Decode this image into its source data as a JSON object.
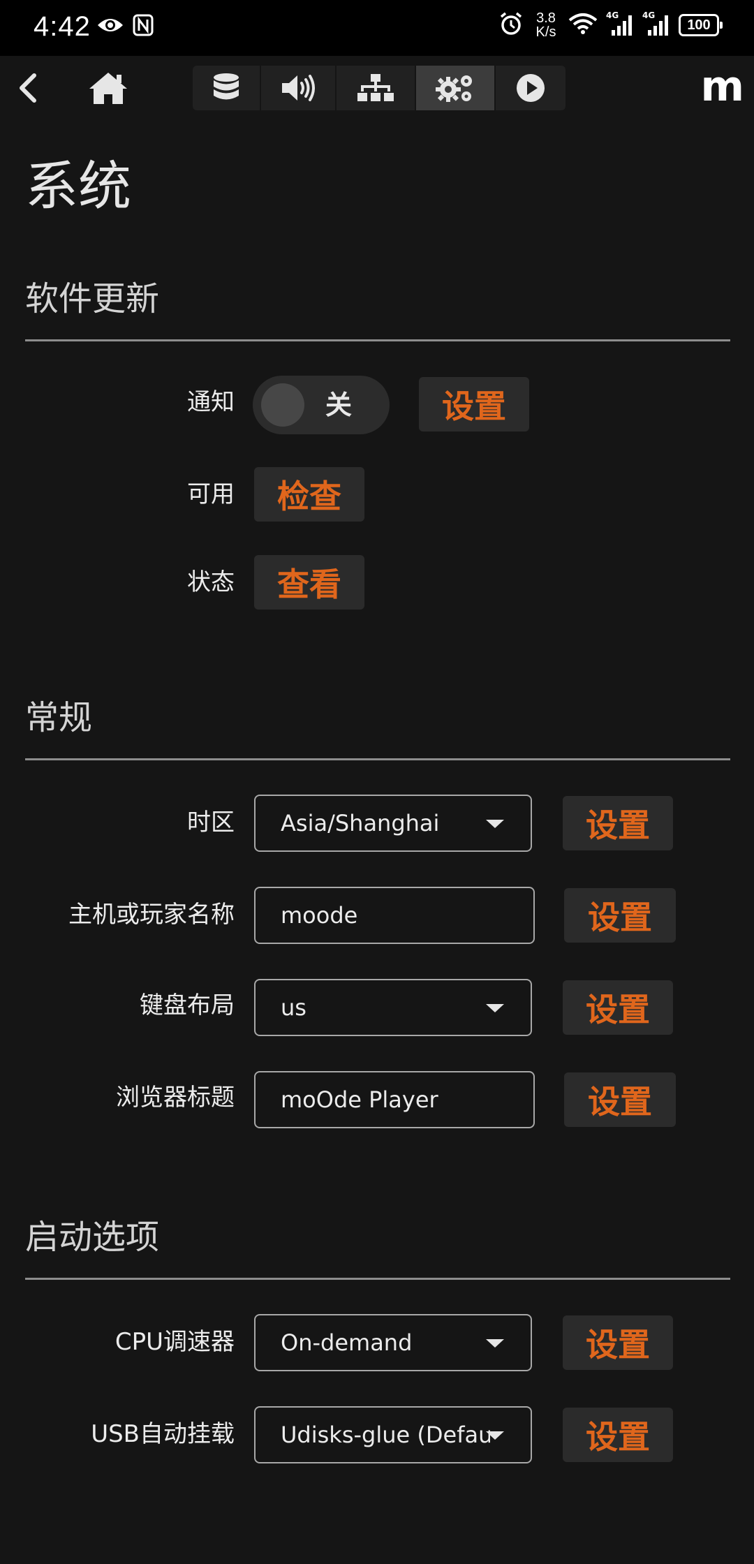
{
  "status_bar": {
    "time": "4:42",
    "net_speed_value": "3.8",
    "net_speed_unit": "K/s",
    "network_label_1": "4G",
    "network_label_2": "4G",
    "battery": "100"
  },
  "nav": {
    "brand": "m",
    "tabs": [
      {
        "name": "library",
        "icon": "database-icon"
      },
      {
        "name": "audio",
        "icon": "speaker-icon"
      },
      {
        "name": "network",
        "icon": "sitemap-icon"
      },
      {
        "name": "system",
        "icon": "gears-icon",
        "active": true
      },
      {
        "name": "playback",
        "icon": "play-circle-icon"
      }
    ]
  },
  "page": {
    "title": "系统"
  },
  "software_update": {
    "heading": "软件更新",
    "notify_label": "通知",
    "notify_toggle": "关",
    "notify_button": "设置",
    "available_label": "可用",
    "check_button": "检查",
    "status_label": "状态",
    "view_button": "查看"
  },
  "general": {
    "heading": "常规",
    "timezone_label": "时区",
    "timezone_value": "Asia/Shanghai",
    "timezone_button": "设置",
    "hostname_label": "主机或玩家名称",
    "hostname_value": "moode",
    "hostname_button": "设置",
    "keyboard_label": "键盘布局",
    "keyboard_value": "us",
    "keyboard_button": "设置",
    "browser_title_label": "浏览器标题",
    "browser_title_value": "moOde Player",
    "browser_title_button": "设置"
  },
  "boot_options": {
    "heading": "启动选项",
    "cpu_label": "CPU调速器",
    "cpu_value": "On-demand",
    "cpu_button": "设置",
    "usb_label": "USB自动挂载",
    "usb_value": "Udisks-glue (Default)",
    "usb_button": "设置"
  },
  "colors": {
    "accent": "#e0661c",
    "background": "#151515",
    "button_bg": "#2b2b2b"
  }
}
